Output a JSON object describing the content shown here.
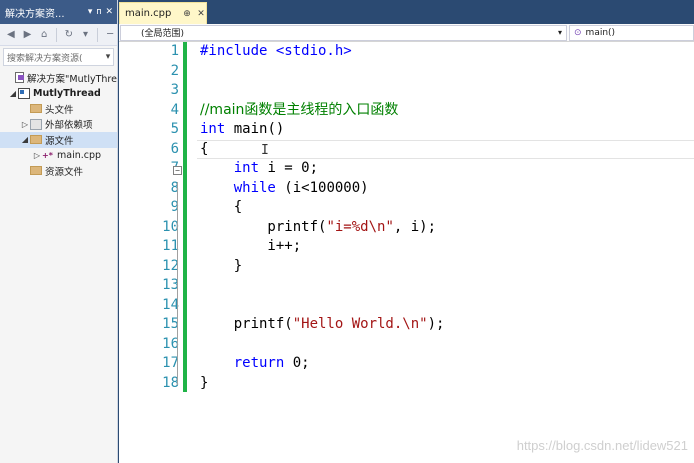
{
  "explorer": {
    "title": "解决方案资...",
    "title_buttons": [
      "▾",
      "ᴨ",
      "✕"
    ],
    "search_placeholder": "搜索解决方案资源(",
    "tree": [
      {
        "label": "解决方案\"MutlyThre",
        "level": 0,
        "icon": "solution-icon",
        "arrow": ""
      },
      {
        "label": "MutlyThread",
        "level": 0,
        "icon": "project-icon",
        "arrow": "◢",
        "bold": true
      },
      {
        "label": "头文件",
        "level": 1,
        "icon": "folder-icon",
        "arrow": ""
      },
      {
        "label": "外部依赖项",
        "level": 1,
        "icon": "references-icon",
        "arrow": "▷"
      },
      {
        "label": "源文件",
        "level": 1,
        "icon": "folder-icon",
        "arrow": "◢",
        "selected": true
      },
      {
        "label": "main.cpp",
        "level": 2,
        "icon": "cpp-file-icon",
        "arrow": "▷"
      },
      {
        "label": "资源文件",
        "level": 1,
        "icon": "folder-icon",
        "arrow": ""
      }
    ]
  },
  "editor": {
    "tab": {
      "name": "main.cpp",
      "pin": "⊕",
      "close": "✕"
    },
    "scope": "(全局范围)",
    "member": "main()",
    "line_numbers": [
      "1",
      "2",
      "3",
      "4",
      "5",
      "6",
      "7",
      "8",
      "9",
      "10",
      "11",
      "12",
      "13",
      "14",
      "15",
      "16",
      "17",
      "18"
    ],
    "lines": [
      [
        {
          "t": "#include <stdio.h>",
          "c": "kw"
        }
      ],
      [],
      [],
      [
        {
          "t": "//main函数是主线程的入口函数",
          "c": "cmt"
        }
      ],
      [
        {
          "t": "int",
          "c": "kw"
        },
        {
          "t": " main()",
          "c": "plain"
        }
      ],
      [
        {
          "t": "{",
          "c": "plain"
        }
      ],
      [
        {
          "t": "    ",
          "c": "plain"
        },
        {
          "t": "int",
          "c": "kw"
        },
        {
          "t": " i = 0;",
          "c": "plain"
        }
      ],
      [
        {
          "t": "    ",
          "c": "plain"
        },
        {
          "t": "while",
          "c": "kw"
        },
        {
          "t": " (i<100000)",
          "c": "plain"
        }
      ],
      [
        {
          "t": "    {",
          "c": "plain"
        }
      ],
      [
        {
          "t": "        printf(",
          "c": "plain"
        },
        {
          "t": "\"i=%d\\n\"",
          "c": "str"
        },
        {
          "t": ", i);",
          "c": "plain"
        }
      ],
      [
        {
          "t": "        i++;",
          "c": "plain"
        }
      ],
      [
        {
          "t": "    }",
          "c": "plain"
        }
      ],
      [],
      [],
      [
        {
          "t": "    printf(",
          "c": "plain"
        },
        {
          "t": "\"Hello World.\\n\"",
          "c": "str"
        },
        {
          "t": ");",
          "c": "plain"
        }
      ],
      [],
      [
        {
          "t": "    ",
          "c": "plain"
        },
        {
          "t": "return",
          "c": "kw"
        },
        {
          "t": " 0;",
          "c": "plain"
        }
      ],
      [
        {
          "t": "}",
          "c": "plain"
        }
      ]
    ],
    "watermark": "https://blog.csdn.net/lidew521"
  }
}
